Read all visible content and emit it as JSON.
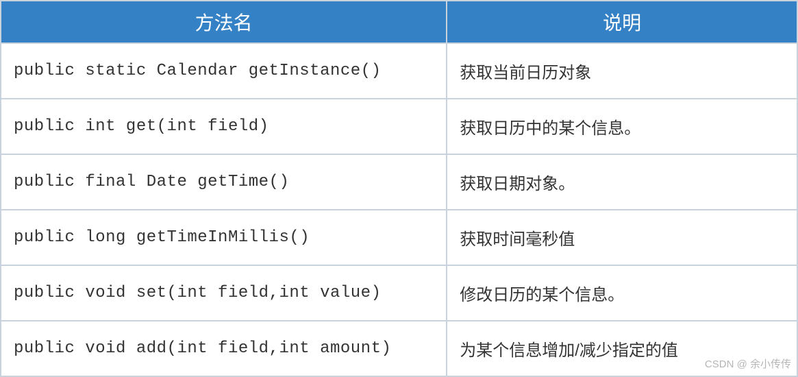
{
  "table": {
    "headers": [
      "方法名",
      "说明"
    ],
    "rows": [
      {
        "method": "public static Calendar getInstance()",
        "desc": "获取当前日历对象"
      },
      {
        "method": "public int get(int field)",
        "desc": "获取日历中的某个信息。"
      },
      {
        "method": "public final Date getTime()",
        "desc": "获取日期对象。"
      },
      {
        "method": "public long getTimeInMillis()",
        "desc": "获取时间毫秒值"
      },
      {
        "method": "public void set(int field,int value)",
        "desc": "修改日历的某个信息。"
      },
      {
        "method": "public void add(int field,int amount)",
        "desc": "为某个信息增加/减少指定的值"
      }
    ]
  },
  "watermark": "CSDN @ 余小传传"
}
